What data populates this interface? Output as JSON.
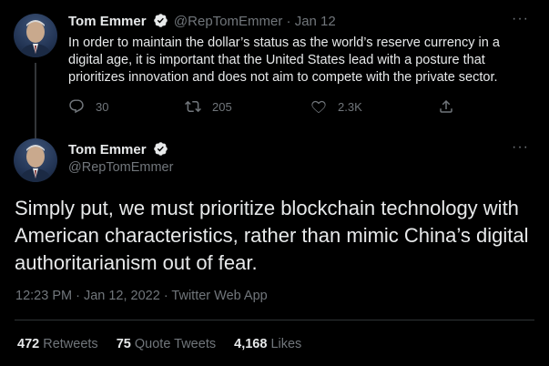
{
  "tweet1": {
    "name": "Tom Emmer",
    "handle": "@RepTomEmmer",
    "separator": "·",
    "date": "Jan 12",
    "text": "In order to maintain the dollar’s status as the world’s reserve currency in a digital age, it is important that the United States lead with a posture that prioritizes innovation and does not aim to compete with the private sector.",
    "replies": "30",
    "retweets": "205",
    "likes": "2.3K"
  },
  "tweet2": {
    "name": "Tom Emmer",
    "handle": "@RepTomEmmer",
    "text": "Simply put, we must prioritize blockchain technology with American characteristics, rather than mimic China’s digital authoritarianism out of fear.",
    "meta": "12:23 PM · Jan 12, 2022 · Twitter Web App",
    "retweets_count": "472",
    "retweets_label": "Retweets",
    "quotes_count": "75",
    "quotes_label": "Quote Tweets",
    "likes_count": "4,168",
    "likes_label": "Likes"
  },
  "more_label": "···",
  "colors": {
    "background": "#000000",
    "text": "#e7e9ea",
    "muted": "#71767b",
    "verified": "#e7e9ea",
    "divider": "#2f3336"
  },
  "icons": [
    "verified-badge-icon",
    "reply-icon",
    "retweet-icon",
    "like-icon",
    "share-icon",
    "more-icon"
  ]
}
